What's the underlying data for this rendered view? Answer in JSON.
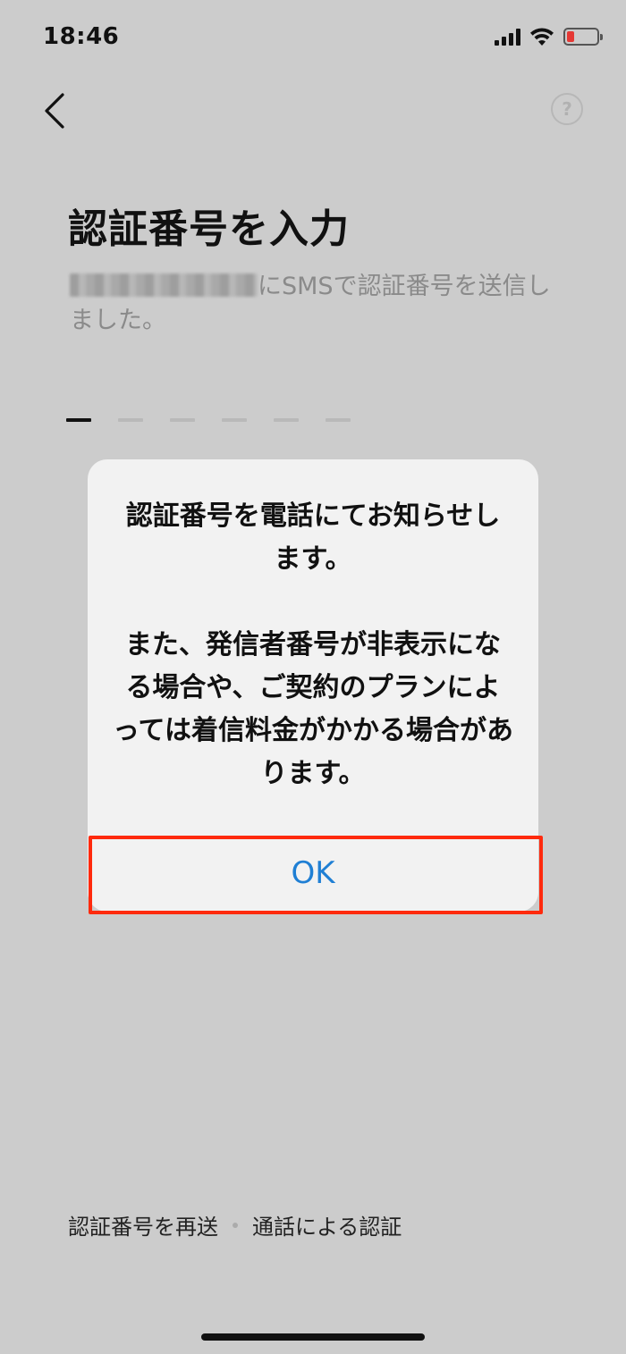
{
  "status_bar": {
    "time": "18:46",
    "battery_color": "#e53935"
  },
  "header": {
    "back_icon": "chevron-left-icon",
    "help_label": "?"
  },
  "main": {
    "title": "認証番号を入力",
    "subtitle_masked": "",
    "subtitle_text": "にSMSで認証番号を送信しました。",
    "code_slots": 6
  },
  "dialog": {
    "message_line1": "認証番号を電話にてお知らせします。",
    "message_line2": "また、発信者番号が非表示になる場合や、ご契約のプランによっては着信料金がかかる場合があります。",
    "ok_label": "OK",
    "ok_color": "#1f7fd4",
    "highlight_color": "#ff2a0d"
  },
  "footer": {
    "resend_label": "認証番号を再送",
    "call_label": "通話による認証"
  }
}
